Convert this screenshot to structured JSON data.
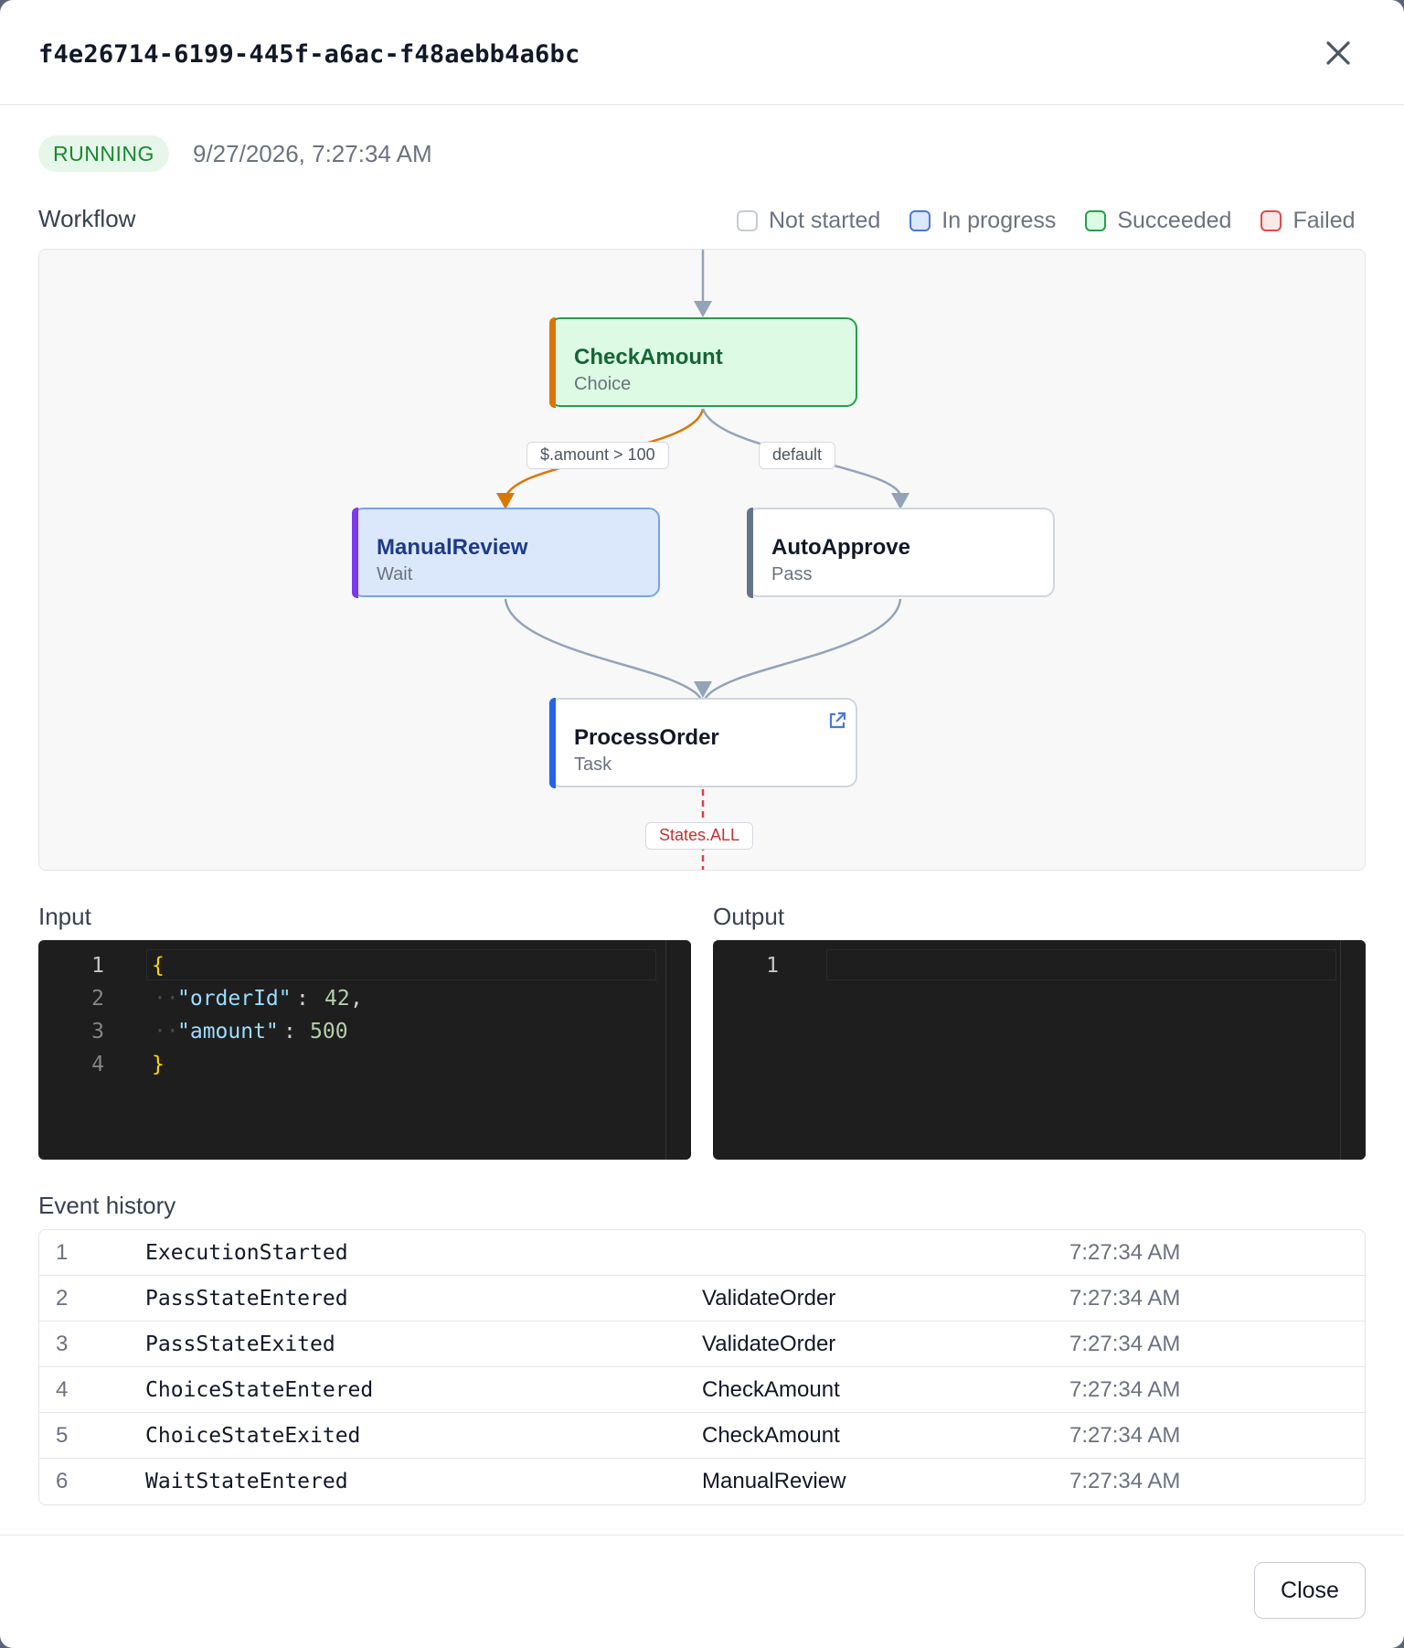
{
  "header": {
    "execution_id": "f4e26714-6199-445f-a6ac-f48aebb4a6bc",
    "close_icon": "close-icon"
  },
  "status": {
    "label": "RUNNING",
    "timestamp": "9/27/2026, 7:27:34 AM",
    "color": "#178a2e"
  },
  "workflow": {
    "label": "Workflow",
    "legend": [
      {
        "label": "Not started",
        "border": "#c6ccd5",
        "fill": "#ffffff"
      },
      {
        "label": "In progress",
        "border": "#4a78d8",
        "fill": "#dbe8fb"
      },
      {
        "label": "Succeeded",
        "border": "#23a04a",
        "fill": "#dcfae4"
      },
      {
        "label": "Failed",
        "border": "#e04a4a",
        "fill": "#fde8e8"
      }
    ],
    "nodes": {
      "check_amount": {
        "name": "CheckAmount",
        "type": "Choice",
        "status": "Succeeded",
        "accent": "#d97706"
      },
      "manual_review": {
        "name": "ManualReview",
        "type": "Wait",
        "status": "In progress",
        "accent": "#7c3aed"
      },
      "auto_approve": {
        "name": "AutoApprove",
        "type": "Pass",
        "status": "Not started",
        "accent": "#64748b"
      },
      "process_order": {
        "name": "ProcessOrder",
        "type": "Task",
        "status": "Not started",
        "accent": "#2563eb",
        "icon": "external-link-icon"
      }
    },
    "edge_labels": {
      "amount_condition": "$.amount > 100",
      "default": "default",
      "catch": "States.ALL"
    }
  },
  "input": {
    "label": "Input",
    "line_numbers": [
      "1",
      "2",
      "3",
      "4"
    ],
    "open_brace": "{",
    "key1": "\"orderId\"",
    "val1": "42",
    "key2": "\"amount\"",
    "val2": "500",
    "close_brace": "}"
  },
  "output": {
    "label": "Output",
    "line_numbers": [
      "1"
    ]
  },
  "events": {
    "label": "Event history",
    "rows": [
      {
        "num": "1",
        "type": "ExecutionStarted",
        "state": "",
        "time": "7:27:34 AM"
      },
      {
        "num": "2",
        "type": "PassStateEntered",
        "state": "ValidateOrder",
        "time": "7:27:34 AM"
      },
      {
        "num": "3",
        "type": "PassStateExited",
        "state": "ValidateOrder",
        "time": "7:27:34 AM"
      },
      {
        "num": "4",
        "type": "ChoiceStateEntered",
        "state": "CheckAmount",
        "time": "7:27:34 AM"
      },
      {
        "num": "5",
        "type": "ChoiceStateExited",
        "state": "CheckAmount",
        "time": "7:27:34 AM"
      },
      {
        "num": "6",
        "type": "WaitStateEntered",
        "state": "ManualReview",
        "time": "7:27:34 AM"
      }
    ]
  },
  "footer": {
    "close_label": "Close"
  }
}
